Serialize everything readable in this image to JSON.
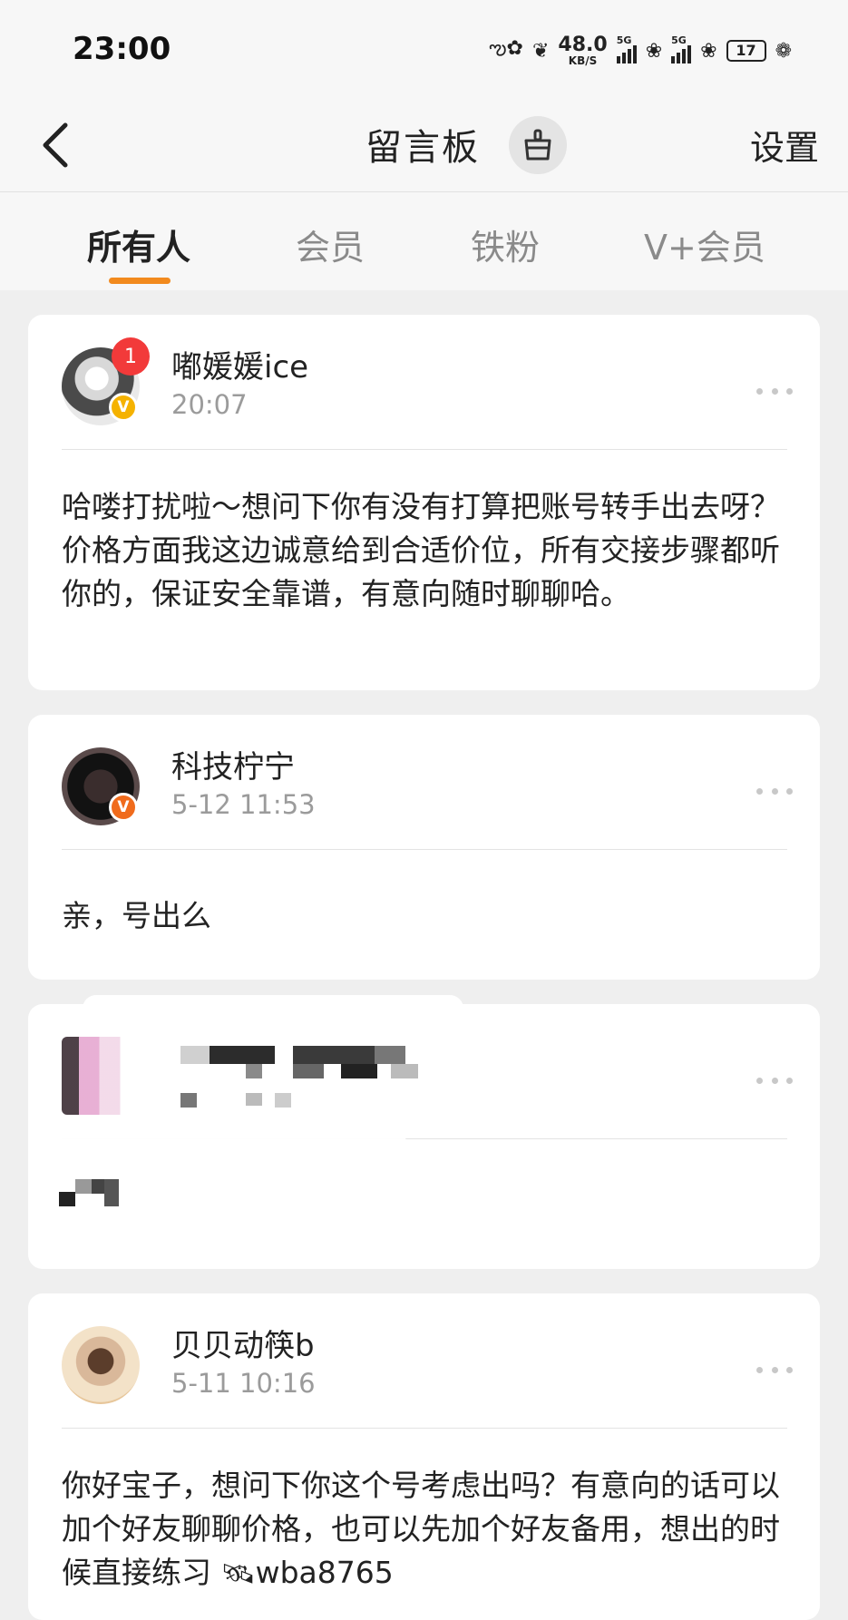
{
  "status_bar": {
    "time": "23:00",
    "net_speed_value": "48.0",
    "net_speed_unit": "KB/S",
    "signal1_label": "5G",
    "signal2_label": "5G",
    "battery": "17"
  },
  "header": {
    "back_icon": "chevron-left-icon",
    "title": "留言板",
    "clean_icon": "broom-icon",
    "settings_label": "设置"
  },
  "tabs": [
    {
      "label": "所有人",
      "active": true
    },
    {
      "label": "会员",
      "active": false
    },
    {
      "label": "铁粉",
      "active": false
    },
    {
      "label": "V+会员",
      "active": false
    }
  ],
  "accent_color": "#f28a1e",
  "messages": [
    {
      "username": "嘟媛媛ice",
      "time": "20:07",
      "unread_count": "1",
      "verified_badge": "V",
      "text": "哈喽打扰啦～想问下你有没有打算把账号转手出去呀？价格方面我这边诚意给到合适价位，所有交接步骤都听你的，保证安全靠谱，有意向随时聊聊哈。"
    },
    {
      "username": "科技柠宁",
      "time": "5-12 11:53",
      "verified_badge": "V",
      "text": "亲，号出么"
    },
    {
      "username": "",
      "time": "",
      "text": "",
      "redacted": true
    },
    {
      "username": "贝贝动筷b",
      "time": "5-11 10:16",
      "text": "你好宝子，想问下你这个号考虑出吗？有意向的话可以加个好友聊聊价格，也可以先加个好友备用，想出的时候直接练习",
      "contact_icon": "satellite-icon",
      "contact_id": "wba8765"
    }
  ]
}
